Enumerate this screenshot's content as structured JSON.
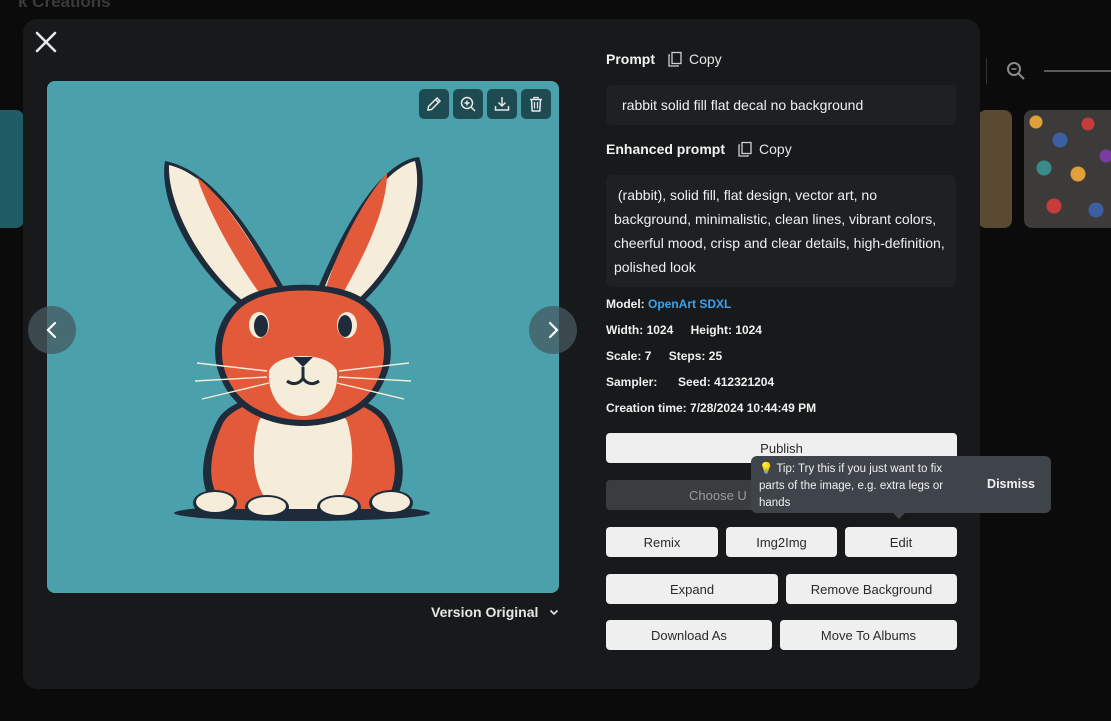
{
  "background": {
    "title": "k Creations"
  },
  "modal": {
    "prompt": {
      "label": "Prompt",
      "copy_label": "Copy",
      "text": "rabbit solid fill flat decal no background"
    },
    "enhanced_prompt": {
      "label": "Enhanced prompt",
      "copy_label": "Copy",
      "text": " (rabbit), solid fill, flat design, vector art, no background, minimalistic, clean lines, vibrant colors, cheerful mood, crisp and clear details, high-definition, polished look"
    },
    "meta": {
      "model_label": "Model:",
      "model_value": "OpenArt SDXL",
      "width_label": "Width:",
      "width_value": "1024",
      "height_label": "Height:",
      "height_value": "1024",
      "scale_label": "Scale:",
      "scale_value": "7",
      "steps_label": "Steps:",
      "steps_value": "25",
      "sampler_label": "Sampler:",
      "sampler_value": "",
      "seed_label": "Seed:",
      "seed_value": "412321204",
      "creation_label": "Creation time:",
      "creation_value": "7/28/2024 10:44:49 PM"
    },
    "version_label": "Version Original",
    "buttons": {
      "publish": "Publish",
      "choose": "Choose U",
      "remix": "Remix",
      "img2img": "Img2Img",
      "edit": "Edit",
      "expand": "Expand",
      "remove_background": "Remove Background",
      "download_as": "Download As",
      "move_to_albums": "Move To Albums"
    },
    "tooltip": {
      "icon": "lightbulb-icon",
      "text": "Tip: Try this if you just want to fix parts of the image, e.g. extra legs or hands",
      "dismiss": "Dismiss"
    },
    "image_tools": [
      "pencil-icon",
      "zoom-in-icon",
      "download-icon",
      "trash-icon"
    ]
  },
  "colors": {
    "modal_bg": "#17191b",
    "image_bg": "#4aa0ab",
    "accent_link": "#3aa3f0",
    "button_bg": "#efefef",
    "tooltip_bg": "#3e4449"
  }
}
